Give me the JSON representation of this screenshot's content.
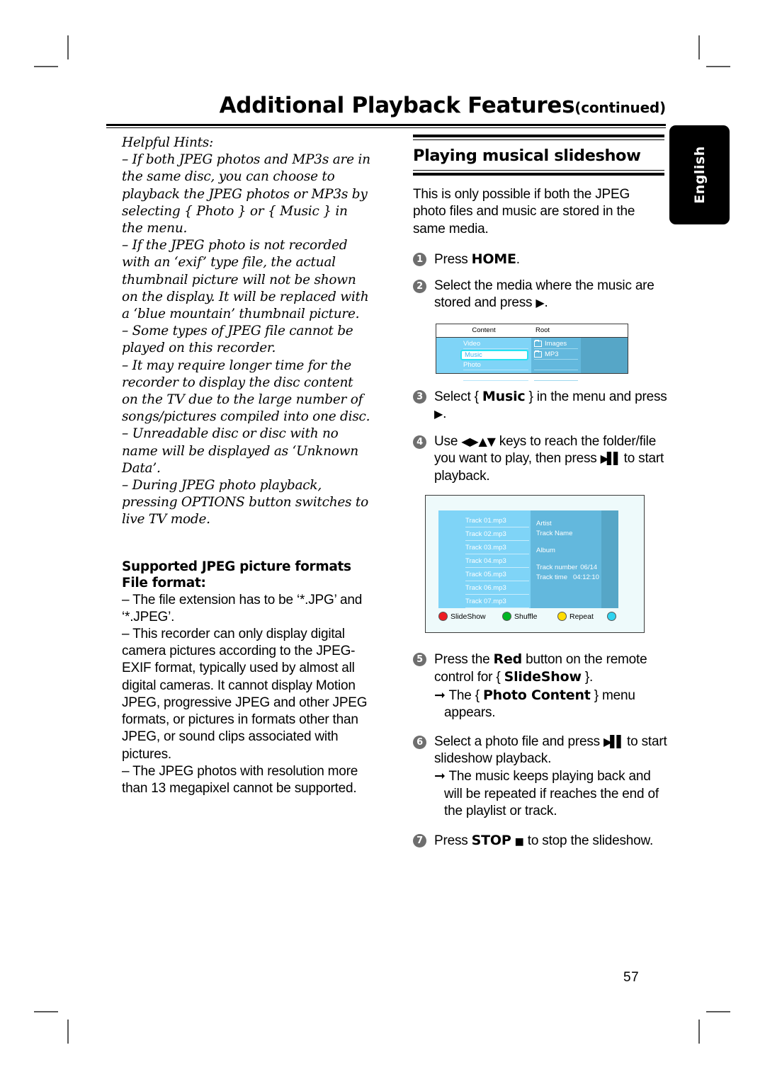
{
  "header": {
    "title_main": "Additional Playback Features",
    "title_continued": "(continued)"
  },
  "lang_tab": {
    "label": "English"
  },
  "left_column": {
    "hints_title": "Helpful Hints:",
    "hints": [
      "– If both JPEG photos and MP3s are in the same disc, you can choose to playback the JPEG photos or MP3s by selecting { Photo } or { Music } in the menu.",
      "– If the JPEG photo is not recorded with an ‘exif’ type file, the actual thumbnail picture will not be shown on the display.  It will be replaced with a ‘blue mountain’ thumbnail picture.",
      "– Some types of JPEG file cannot be played on this recorder.",
      "– It may require longer time for the recorder to display the disc content on the TV due to the large number of songs/pictures compiled into one disc.",
      "– Unreadable disc or disc with no name will be displayed as ‘Unknown Data’.",
      "– During JPEG photo playback, pressing OPTIONS button switches to live TV mode."
    ],
    "formats_heading_line1": "Supported JPEG picture formats",
    "formats_heading_line2": "File format:",
    "formats_body": [
      "– The file extension has to be ‘*.JPG’ and ‘*.JPEG’.",
      "– This recorder can only display digital camera pictures according to the JPEG-EXIF format, typically used by almost all digital cameras.  It cannot display Motion JPEG, progressive JPEG and other JPEG formats, or pictures in formats other than JPEG, or sound clips associated with pictures.",
      "– The JPEG photos with resolution more than 13 megapixel cannot be supported."
    ]
  },
  "right_column": {
    "section_title": "Playing musical slideshow",
    "intro": "This is only possible if both the JPEG photo files and music are stored in the same media.",
    "steps": [
      {
        "num": "1",
        "text_before": "Press ",
        "bold": "HOME",
        "text_after": "."
      },
      {
        "num": "2",
        "text_before": "Select the media where the music are stored and press ",
        "bold": "",
        "text_after": "."
      },
      {
        "num": "3",
        "text_before": "Select { ",
        "bold": "Music",
        "text_after": " } in the menu and press "
      },
      {
        "num": "4",
        "text_before": "Use ",
        "bold": "",
        "text_after": " keys to reach the folder/file you want to play, then press "
      },
      {
        "num": "5",
        "text_before": "Press the ",
        "bold": "Red",
        "text_after": " button on the remote control for { ",
        "bold2": "SlideShow",
        "text_after2": " }."
      },
      {
        "num": "6",
        "text_before": "Select a photo file and press ",
        "bold": "",
        "text_after": " to start slideshow playback."
      },
      {
        "num": "7",
        "text_before": "Press ",
        "bold": "STOP",
        "text_after": " to stop the slideshow."
      }
    ],
    "step4_tail": " to start playback.",
    "step5_sub_pre": "The { ",
    "step5_sub_bold": "Photo Content",
    "step5_sub_post": " } menu appears.",
    "step6_sub": "The music keeps playing back and will be repeated if reaches the end of the playlist or track."
  },
  "screenshot_content_root": {
    "header_left": "Content",
    "header_right": "Root",
    "menu_items": [
      "Video",
      "Music",
      "Photo"
    ],
    "selected_item": "Music",
    "files": [
      "Images",
      "MP3"
    ],
    "colors": {
      "col_a": "#7fd4f7",
      "col_b": "#63b8dd",
      "col_c": "#56a6c7",
      "selection_border": "#27e3f3",
      "selection_text": "#3ab6ef"
    }
  },
  "screenshot_track_list": {
    "tracks": [
      "Track 01.mp3",
      "Track 02.mp3",
      "Track 03.mp3",
      "Track 04.mp3",
      "Track 05.mp3",
      "Track 06.mp3",
      "Track 07.mp3"
    ],
    "info": {
      "artist": "Artist",
      "track_name": "Track Name",
      "album": "Album",
      "track_number_label": "Track number",
      "track_number_value": "06/14",
      "track_time_label": "Track time",
      "track_time_value": "04:12:10"
    },
    "color_buttons": [
      {
        "label": "SlideShow",
        "color": "#ee1c24"
      },
      {
        "label": "Shuffle",
        "color": "#00b624"
      },
      {
        "label": "Repeat",
        "color": "#ffdd00"
      },
      {
        "label": "",
        "color": "#2fd3ef"
      }
    ],
    "colors": {
      "background": "#eefafb",
      "list_bg": "#7fd4f7",
      "info_bg": "#63b8dd",
      "right_bg": "#56a6c7"
    }
  },
  "footer": {
    "page_number": "57"
  }
}
